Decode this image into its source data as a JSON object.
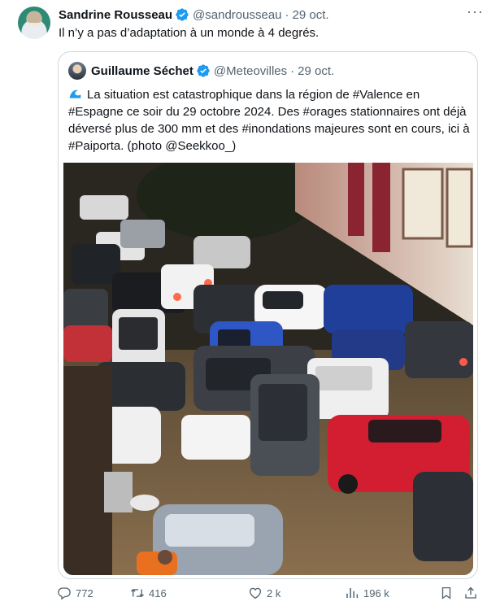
{
  "tweet": {
    "author_name": "Sandrine Rousseau",
    "author_handle": "@sandrousseau",
    "separator": "·",
    "date": "29 oct.",
    "more": "···",
    "text": "Il n’y a pas d’adaptation à un monde à 4 degrés."
  },
  "quote": {
    "author_name": "Guillaume Séchet",
    "author_handle": "@Meteovilles",
    "separator": "·",
    "date": "29 oct.",
    "text_parts": {
      "p1": "La situation est catastrophique dans la région de ",
      "tag_valence": "#Valence",
      "p2": " en ",
      "tag_espagne": "#Espagne",
      "p3": " ce soir du 29 octobre 2024. Des ",
      "tag_orages": "#orages",
      "p4": " stationnaires ont déjà déversé plus de 300 mm et des ",
      "tag_inondations": "#inondations",
      "p5": " majeures sont en cours, ici à ",
      "tag_paiporta": "#Paiporta",
      "p6": ". (photo @Seekkoo_)"
    },
    "icon": "water-wave-icon"
  },
  "actions": {
    "replies": "772",
    "retweets": "416",
    "likes": "2 k",
    "views": "196 k"
  },
  "colors": {
    "text": "#0f1419",
    "secondary": "#536471",
    "verified": "#1d9bf0",
    "border": "#cfd9de"
  }
}
